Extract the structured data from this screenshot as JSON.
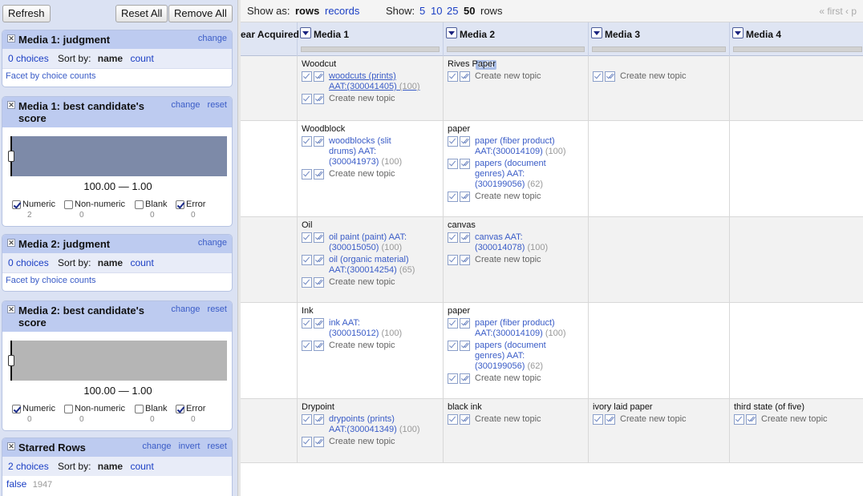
{
  "left": {
    "refresh": "Refresh",
    "reset_all": "Reset All",
    "remove_all": "Remove All",
    "facets": [
      {
        "title": "Media 1: judgment",
        "actions": [
          "change"
        ],
        "choices": "0 choices",
        "sort_by": "Sort by:",
        "sort_name": "name",
        "sort_count": "count",
        "foot": "Facet by choice counts"
      },
      {
        "title": "Media 1: best candidate's",
        "title2": "score",
        "actions": [
          "change",
          "reset"
        ],
        "range": "100.00 — 1.00",
        "hist_color": "#7d8aa8",
        "checks": [
          {
            "label": "Numeric",
            "checked": true,
            "count": "2"
          },
          {
            "label": "Non-numeric",
            "checked": false,
            "count": "0"
          },
          {
            "label": "Blank",
            "checked": false,
            "count": "0"
          },
          {
            "label": "Error",
            "checked": true,
            "count": "0"
          }
        ]
      },
      {
        "title": "Media 2: judgment",
        "actions": [
          "change"
        ],
        "choices": "0 choices",
        "sort_by": "Sort by:",
        "sort_name": "name",
        "sort_count": "count",
        "foot": "Facet by choice counts"
      },
      {
        "title": "Media 2: best candidate's",
        "title2": "score",
        "actions": [
          "change",
          "reset"
        ],
        "range": "100.00 — 1.00",
        "hist_color": "#b5b5b5",
        "checks": [
          {
            "label": "Numeric",
            "checked": true,
            "count": "0"
          },
          {
            "label": "Non-numeric",
            "checked": false,
            "count": "0"
          },
          {
            "label": "Blank",
            "checked": false,
            "count": "0"
          },
          {
            "label": "Error",
            "checked": true,
            "count": "0"
          }
        ]
      },
      {
        "title": "Starred Rows",
        "actions": [
          "change",
          "invert",
          "reset"
        ],
        "choices": "2 choices",
        "sort_by": "Sort by:",
        "sort_name": "name",
        "sort_count": "count",
        "item_label": "false",
        "item_count": "1947"
      }
    ]
  },
  "toolbar": {
    "show_as": "Show as:",
    "rows": "rows",
    "records": "records",
    "show": "Show:",
    "sizes": [
      "5",
      "10",
      "25",
      "50"
    ],
    "rows_label": "rows",
    "pager": "« first  ‹ p"
  },
  "columns": [
    "ear Acquired",
    "Media 1",
    "Media 2",
    "Media 3",
    "Media 4"
  ],
  "edit_label": "edit",
  "new_topic": "Create new topic",
  "rows": [
    {
      "m1_val": "Woodcut",
      "m1_cands": [
        {
          "lines": [
            "woodcuts (prints)",
            "AAT:(300041405)"
          ],
          "score": "(100)"
        }
      ],
      "m2_val": "Rives Paper",
      "m2_cands": [],
      "m3_val": "",
      "m4_val": ""
    },
    {
      "m1_val": "Woodblock",
      "m1_cands": [
        {
          "lines": [
            "woodblocks (slit",
            "drums) AAT:",
            "(300041973)"
          ],
          "score": "(100)"
        }
      ],
      "m2_val": "paper",
      "m2_cands": [
        {
          "lines": [
            "paper (fiber product)",
            "AAT:(300014109)"
          ],
          "score": "(100)"
        },
        {
          "lines": [
            "papers (document",
            "genres) AAT:",
            "(300199056)"
          ],
          "score": "(62)"
        }
      ]
    },
    {
      "m1_val": "Oil",
      "m1_cands": [
        {
          "lines": [
            "oil paint (paint) AAT:",
            "(300015050)"
          ],
          "score": "(100)"
        },
        {
          "lines": [
            "oil (organic material)",
            "AAT:(300014254)"
          ],
          "score": "(65)"
        }
      ],
      "m2_val": "canvas",
      "m2_cands": [
        {
          "lines": [
            "canvas AAT:",
            "(300014078)"
          ],
          "score": "(100)"
        }
      ]
    },
    {
      "m1_val": "Ink",
      "m1_cands": [
        {
          "lines": [
            "ink AAT:",
            "(300015012)"
          ],
          "score": "(100)"
        }
      ],
      "m2_val": "paper",
      "m2_cands": [
        {
          "lines": [
            "paper (fiber product)",
            "AAT:(300014109)"
          ],
          "score": "(100)"
        },
        {
          "lines": [
            "papers (document",
            "genres) AAT:",
            "(300199056)"
          ],
          "score": "(62)"
        }
      ]
    },
    {
      "m1_val": "Drypoint",
      "m1_cands": [
        {
          "lines": [
            "drypoints (prints)",
            "AAT:(300041349)"
          ],
          "score": "(100)"
        }
      ],
      "m2_val": "black ink",
      "m2_cands": [],
      "m3_val": "ivory laid paper",
      "m4_val": "third state (of five)"
    }
  ]
}
